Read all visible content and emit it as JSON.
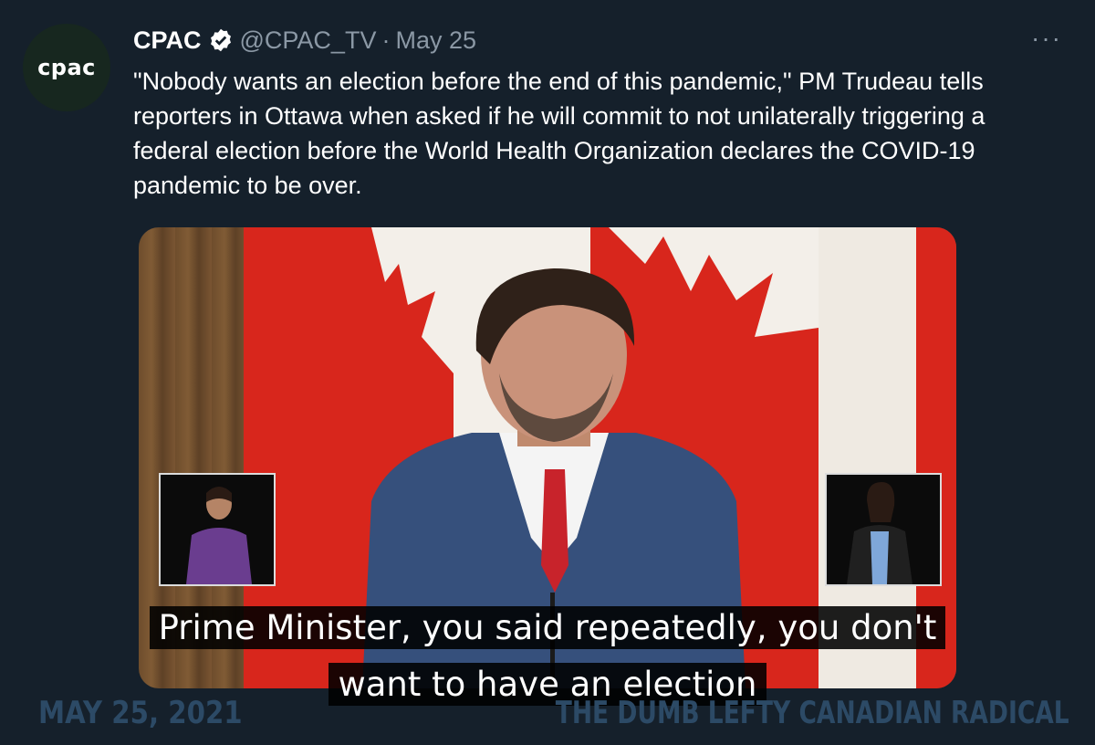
{
  "tweet": {
    "avatar_text": "cpac",
    "author_name": "CPAC",
    "handle": "@CPAC_TV",
    "separator": "·",
    "date": "May 25",
    "more_label": "···",
    "text": "\"Nobody wants an election before the end of this pandemic,\" PM Trudeau tells reporters in Ottawa when asked if he will commit to not unilaterally triggering a federal election before the World Health Organization declares the COVID-19 pandemic to be over."
  },
  "video": {
    "caption_line1": "Prime Minister, you said repeatedly, you don't",
    "caption_line2": "want to have an election"
  },
  "watermark": {
    "date": "MAY 25, 2021",
    "credit": "THE DUMB LEFTY CANADIAN RADICAL"
  },
  "colors": {
    "background": "#15202b",
    "flag_red": "#d8261c",
    "watermark": "#2c4a66"
  }
}
